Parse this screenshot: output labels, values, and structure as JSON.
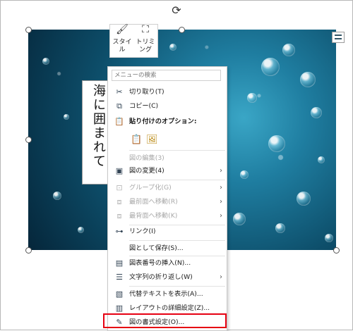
{
  "mini_toolbar": {
    "style_label": "スタイル",
    "trim_label": "トリミング",
    "style_icon": "picture-style-icon",
    "trim_icon": "crop-icon"
  },
  "textbox": {
    "text": "海に囲まれて"
  },
  "context_menu": {
    "search_placeholder": "メニューの検索",
    "items": [
      {
        "label": "切り取り(T)",
        "icon": "scissors-icon",
        "disabled": false
      },
      {
        "label": "コピー(C)",
        "icon": "copy-icon",
        "disabled": false
      },
      {
        "label": "貼り付けのオプション:",
        "icon": "paste-icon",
        "disabled": false
      },
      {
        "label": "図の編集(3)",
        "icon": "",
        "disabled": true
      },
      {
        "label": "図の変更(4)",
        "icon": "change-picture-icon",
        "disabled": false
      },
      {
        "label": "グループ化(G)",
        "icon": "group-icon",
        "disabled": true
      },
      {
        "label": "最前面へ移動(R)",
        "icon": "bring-front-icon",
        "disabled": true
      },
      {
        "label": "最背面へ移動(K)",
        "icon": "send-back-icon",
        "disabled": true
      },
      {
        "label": "リンク(I)",
        "icon": "link-icon",
        "disabled": false
      },
      {
        "label": "図として保存(S)...",
        "icon": "",
        "disabled": false
      },
      {
        "label": "図表番号の挿入(N)...",
        "icon": "caption-icon",
        "disabled": false
      },
      {
        "label": "文字列の折り返し(W)",
        "icon": "wrap-text-icon",
        "disabled": false
      },
      {
        "label": "代替テキストを表示(A)...",
        "icon": "alt-text-icon",
        "disabled": false
      },
      {
        "label": "レイアウトの詳細設定(Z)...",
        "icon": "layout-icon",
        "disabled": false
      },
      {
        "label": "図の書式設定(O)...",
        "icon": "format-picture-icon",
        "disabled": false
      }
    ]
  },
  "colors": {
    "highlight": "#e60012",
    "water_dark": "#05263a",
    "water_light": "#3aa6c6"
  }
}
